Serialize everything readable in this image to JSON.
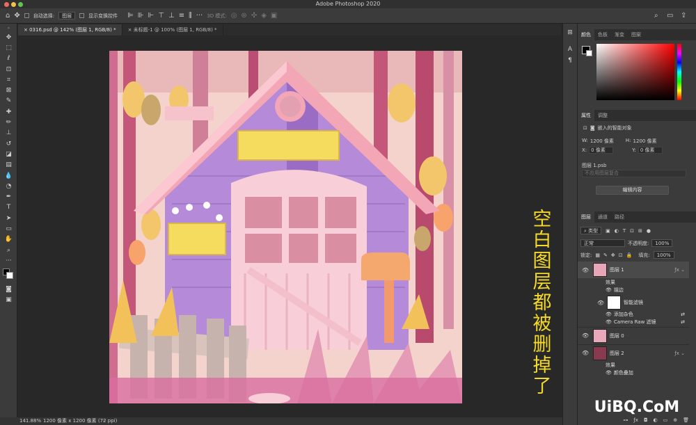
{
  "app": {
    "title": "Adobe Photoshop 2020"
  },
  "options_bar": {
    "auto_select_label": "自动选择:",
    "auto_select_value": "图层",
    "show_transform_label": "显示变换控件",
    "mode_3d_label": "3D 模式:"
  },
  "document_tabs": [
    {
      "label": "0316.psd @ 142% (图层 1, RGB/8) *",
      "active": true
    },
    {
      "label": "未标题-1 @ 100% (图层 1, RGB/8) *",
      "active": false
    }
  ],
  "caption": {
    "text": "空白图层都被删掉了"
  },
  "status_bar": {
    "zoom": "141.88%",
    "doc_info": "1200 像素 x 1200 像素 (72 ppi)"
  },
  "color_panel": {
    "tabs": [
      "颜色",
      "色板",
      "渐变",
      "图案"
    ]
  },
  "properties_panel": {
    "tabs": [
      "属性",
      "调整"
    ],
    "object_type": "嵌入的智能对象",
    "w_label": "W:",
    "w_value": "1200 像素",
    "h_label": "H:",
    "h_value": "1200 像素",
    "x_label": "X:",
    "x_value": "0 像素",
    "y_label": "Y:",
    "y_value": "0 像素",
    "filename": "图层 1.psb",
    "comp_placeholder": "不应用图层复合",
    "edit_button": "编辑内容"
  },
  "layers_panel": {
    "tabs": [
      "图层",
      "通道",
      "路径"
    ],
    "filter_label": "类型",
    "blend_mode": "正常",
    "opacity_label": "不透明度:",
    "opacity_value": "100%",
    "lock_label": "锁定:",
    "fill_label": "填充:",
    "fill_value": "100%",
    "layers": [
      {
        "name": "图层 1",
        "effects_label": "效果",
        "effects": [
          "描边"
        ],
        "smart_filter_label": "智能滤镜",
        "smart_filters": [
          "添加杂色",
          "Camera Raw 滤镜"
        ]
      },
      {
        "name": "图层 0"
      },
      {
        "name": "图层 2",
        "effects_label": "效果",
        "effects": [
          "颜色叠加"
        ]
      }
    ]
  },
  "watermark": {
    "text": "UiBQ.CoM"
  },
  "colors": {
    "accent": "#f4d92a",
    "panel_bg": "#3b3b3b",
    "canvas_bg": "#282828",
    "layer2_thumb": "#8a3a4e"
  }
}
